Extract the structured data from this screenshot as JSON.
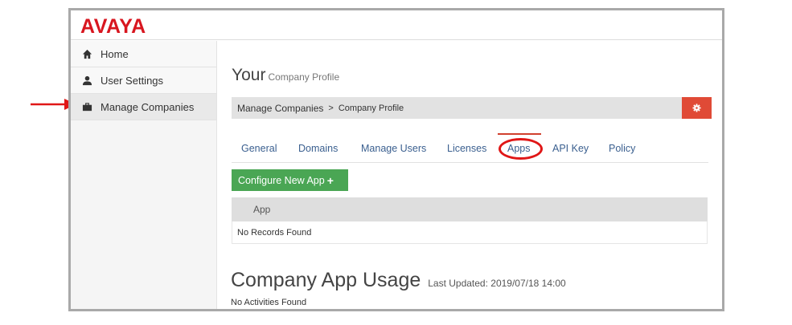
{
  "brand": {
    "logo_text": "AVAYA",
    "color": "#d8161f"
  },
  "sidebar": {
    "items": [
      {
        "label": "Home",
        "icon": "home-icon"
      },
      {
        "label": "User Settings",
        "icon": "user-icon"
      },
      {
        "label": "Manage Companies",
        "icon": "briefcase-icon"
      }
    ]
  },
  "header": {
    "title": "Your",
    "subtitle": "Company Profile"
  },
  "breadcrumb": {
    "root": "Manage Companies",
    "separator": ">",
    "current": "Company Profile"
  },
  "tabs": [
    {
      "label": "General"
    },
    {
      "label": "Domains"
    },
    {
      "label": "Manage Users"
    },
    {
      "label": "Licenses"
    },
    {
      "label": "Apps"
    },
    {
      "label": "API Key"
    },
    {
      "label": "Policy"
    }
  ],
  "apps": {
    "configure_label": "Configure New App",
    "column_header": "App",
    "empty_text": "No Records Found"
  },
  "usage": {
    "title": "Company App Usage",
    "last_updated": "Last Updated: 2019/07/18 14:00",
    "empty_text": "No Activities Found"
  },
  "colors": {
    "accent_red": "#e04a36",
    "button_green": "#4aa654",
    "tab_link": "#3a5f8f",
    "annotation_red": "#e01717"
  }
}
